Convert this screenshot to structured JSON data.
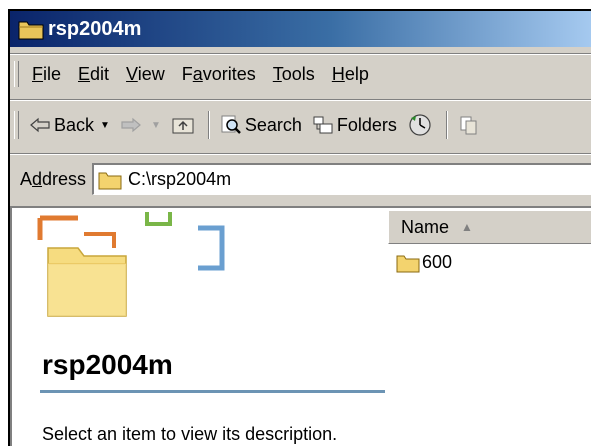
{
  "window": {
    "title": "rsp2004m"
  },
  "menu": [
    "File",
    "Edit",
    "View",
    "Favorites",
    "Tools",
    "Help"
  ],
  "menu_underline": [
    "F",
    "E",
    "V",
    "a",
    "T",
    "H"
  ],
  "toolbar": {
    "back": "Back",
    "search": "Search",
    "folders": "Folders"
  },
  "address": {
    "label": "Address",
    "value": "C:\\rsp2004m"
  },
  "content": {
    "folder_title": "rsp2004m",
    "description": "Select an item to view its description.",
    "column_header": "Name",
    "items": [
      "600"
    ]
  },
  "colors": {
    "title_start": "#0a246a",
    "title_end": "#a6caf0",
    "chrome": "#d4d0c8",
    "rule": "#6c94b4"
  }
}
